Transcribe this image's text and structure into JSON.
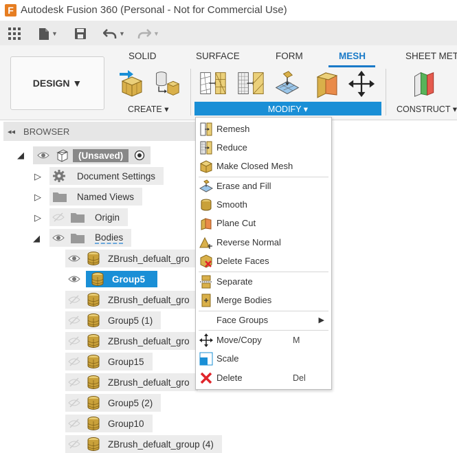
{
  "window": {
    "title": "Autodesk Fusion 360 (Personal - Not for Commercial Use)",
    "logo_letter": "F"
  },
  "quick_access": {
    "caret": "▼"
  },
  "ribbon": {
    "workspace_button": "DESIGN ▼",
    "tabs": [
      "SOLID",
      "SURFACE",
      "FORM",
      "MESH",
      "SHEET METAL"
    ],
    "panels": {
      "create": "CREATE ▾",
      "modify": "MODIFY ▾",
      "construct": "CONSTRUCT ▾"
    }
  },
  "browser": {
    "header": "BROWSER",
    "collapse_glyph": "◂◂",
    "root": "(Unsaved)",
    "folders": [
      "Document Settings",
      "Named Views",
      "Origin",
      "Bodies"
    ],
    "bodies": [
      "ZBrush_defualt_gro",
      "Group5",
      "ZBrush_defualt_gro",
      "Group5 (1)",
      "ZBrush_defualt_gro",
      "Group15",
      "ZBrush_defualt_gro",
      "Group5 (2)",
      "Group10",
      "ZBrush_defualt_group (4)"
    ]
  },
  "modify_menu": {
    "items": [
      {
        "label": "Remesh",
        "shortcut": ""
      },
      {
        "label": "Reduce",
        "shortcut": ""
      },
      {
        "label": "Make Closed Mesh",
        "shortcut": ""
      },
      {
        "label": "Erase and Fill",
        "shortcut": ""
      },
      {
        "label": "Smooth",
        "shortcut": ""
      },
      {
        "label": "Plane Cut",
        "shortcut": ""
      },
      {
        "label": "Reverse Normal",
        "shortcut": ""
      },
      {
        "label": "Delete Faces",
        "shortcut": ""
      },
      {
        "label": "Separate",
        "shortcut": ""
      },
      {
        "label": "Merge Bodies",
        "shortcut": ""
      },
      {
        "label": "Face Groups",
        "shortcut": ""
      },
      {
        "label": "Move/Copy",
        "shortcut": "M"
      },
      {
        "label": "Scale",
        "shortcut": ""
      },
      {
        "label": "Delete",
        "shortcut": "Del"
      }
    ],
    "submenu_arrow": "▶"
  },
  "colors": {
    "accent": "#1a8fd6",
    "mesh_tab": "#1a7ac8",
    "body_gold": "#c9a13a"
  }
}
